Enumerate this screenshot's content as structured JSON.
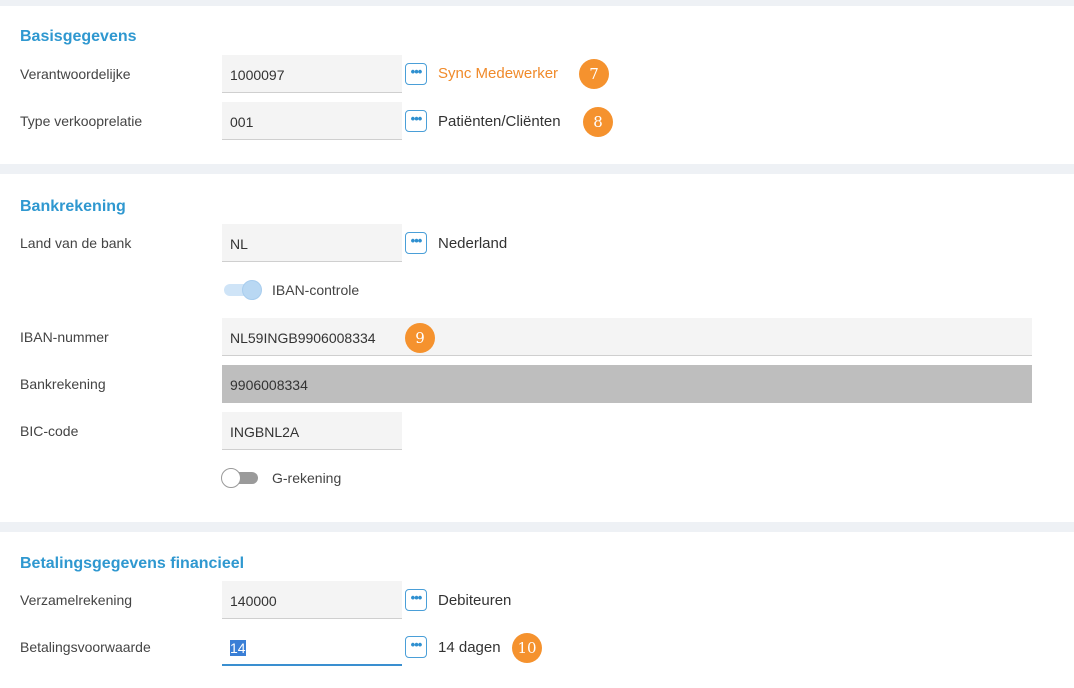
{
  "basis": {
    "title": "Basisgegevens",
    "verantwoordelijke": {
      "label": "Verantwoordelijke",
      "value": "1000097",
      "desc": "Sync Medewerker",
      "badge": "7"
    },
    "type_verkooprelatie": {
      "label": "Type verkooprelatie",
      "value": "001",
      "desc": "Patiënten/Cliënten",
      "badge": "8"
    }
  },
  "bank": {
    "title": "Bankrekening",
    "land": {
      "label": "Land van de bank",
      "value": "NL",
      "desc": "Nederland"
    },
    "iban_controle": {
      "label": "IBAN-controle",
      "on": true
    },
    "iban": {
      "label": "IBAN-nummer",
      "value": "NL59INGB9906008334",
      "badge": "9"
    },
    "bankrekening": {
      "label": "Bankrekening",
      "value": "9906008334"
    },
    "bic": {
      "label": "BIC-code",
      "value": "INGBNL2A"
    },
    "g_rekening": {
      "label": "G-rekening",
      "on": false
    }
  },
  "betaling": {
    "title": "Betalingsgegevens financieel",
    "verzamelrekening": {
      "label": "Verzamelrekening",
      "value": "140000",
      "desc": "Debiteuren"
    },
    "voorwaarde": {
      "label": "Betalingsvoorwaarde",
      "value": "14",
      "desc": "14 dagen",
      "badge": "10"
    }
  },
  "icons": {
    "lookup": "ellipsis-lookup-icon"
  },
  "colors": {
    "accent": "#2f98d0",
    "badge": "#f5922e",
    "link": "#f08a2a"
  }
}
